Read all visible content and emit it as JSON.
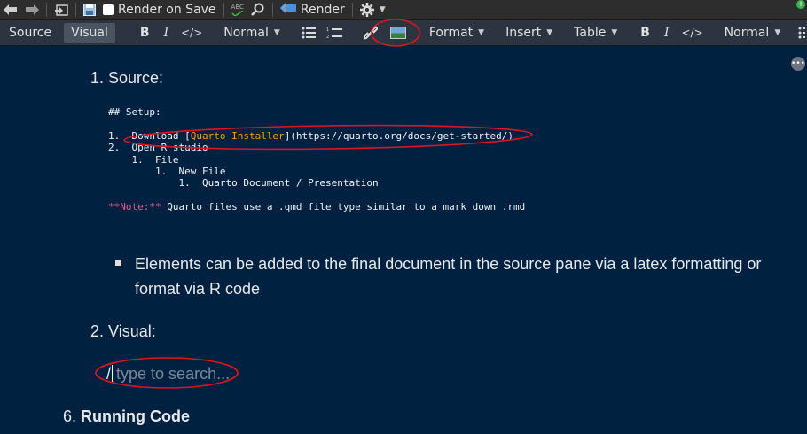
{
  "toolbar_main": {
    "render_on_save_label": "Render on Save",
    "spellcheck_icon_label": "ABC",
    "render_label": "Render"
  },
  "toolbar_visual": {
    "source_tab": "Source",
    "visual_tab": "Visual",
    "bold": "B",
    "italic": "I",
    "code": "</>",
    "style_select": "Normal",
    "format_menu": "Format",
    "insert_menu": "Insert",
    "table_menu": "Table",
    "bold2": "B",
    "italic2": "I",
    "code2": "</>",
    "style_select2": "Normal"
  },
  "document": {
    "item1_label": "1. Source:",
    "code_lines": {
      "l1": "## Setup:",
      "l2": "",
      "l3_prefix": "1.  Download [",
      "l3_link_text": "Quarto Installer",
      "l3_suffix": "](https://quarto.org/docs/get-started/)",
      "l4": "2.  Open R studio",
      "l5": "    1.  File",
      "l6": "        1.  New File",
      "l7": "            1.  Quarto Document / Presentation",
      "l8": "",
      "l9_note": "**Note:**",
      "l9_rest": " Quarto files use a .qmd file type similar to a mark down .rmd"
    },
    "bullet_line1": "Elements can be added to the final document in the source pane via a latex formatting or",
    "bullet_line2": "format via R code",
    "item2_label": "2. Visual:",
    "slash": "/",
    "search_placeholder": "type to search...",
    "item6_number": "6.",
    "item6_label": "Running Code"
  },
  "colors": {
    "background": "#002240",
    "annotation": "#e0141e",
    "link": "#ff9d00",
    "note": "#ff4f8b"
  }
}
